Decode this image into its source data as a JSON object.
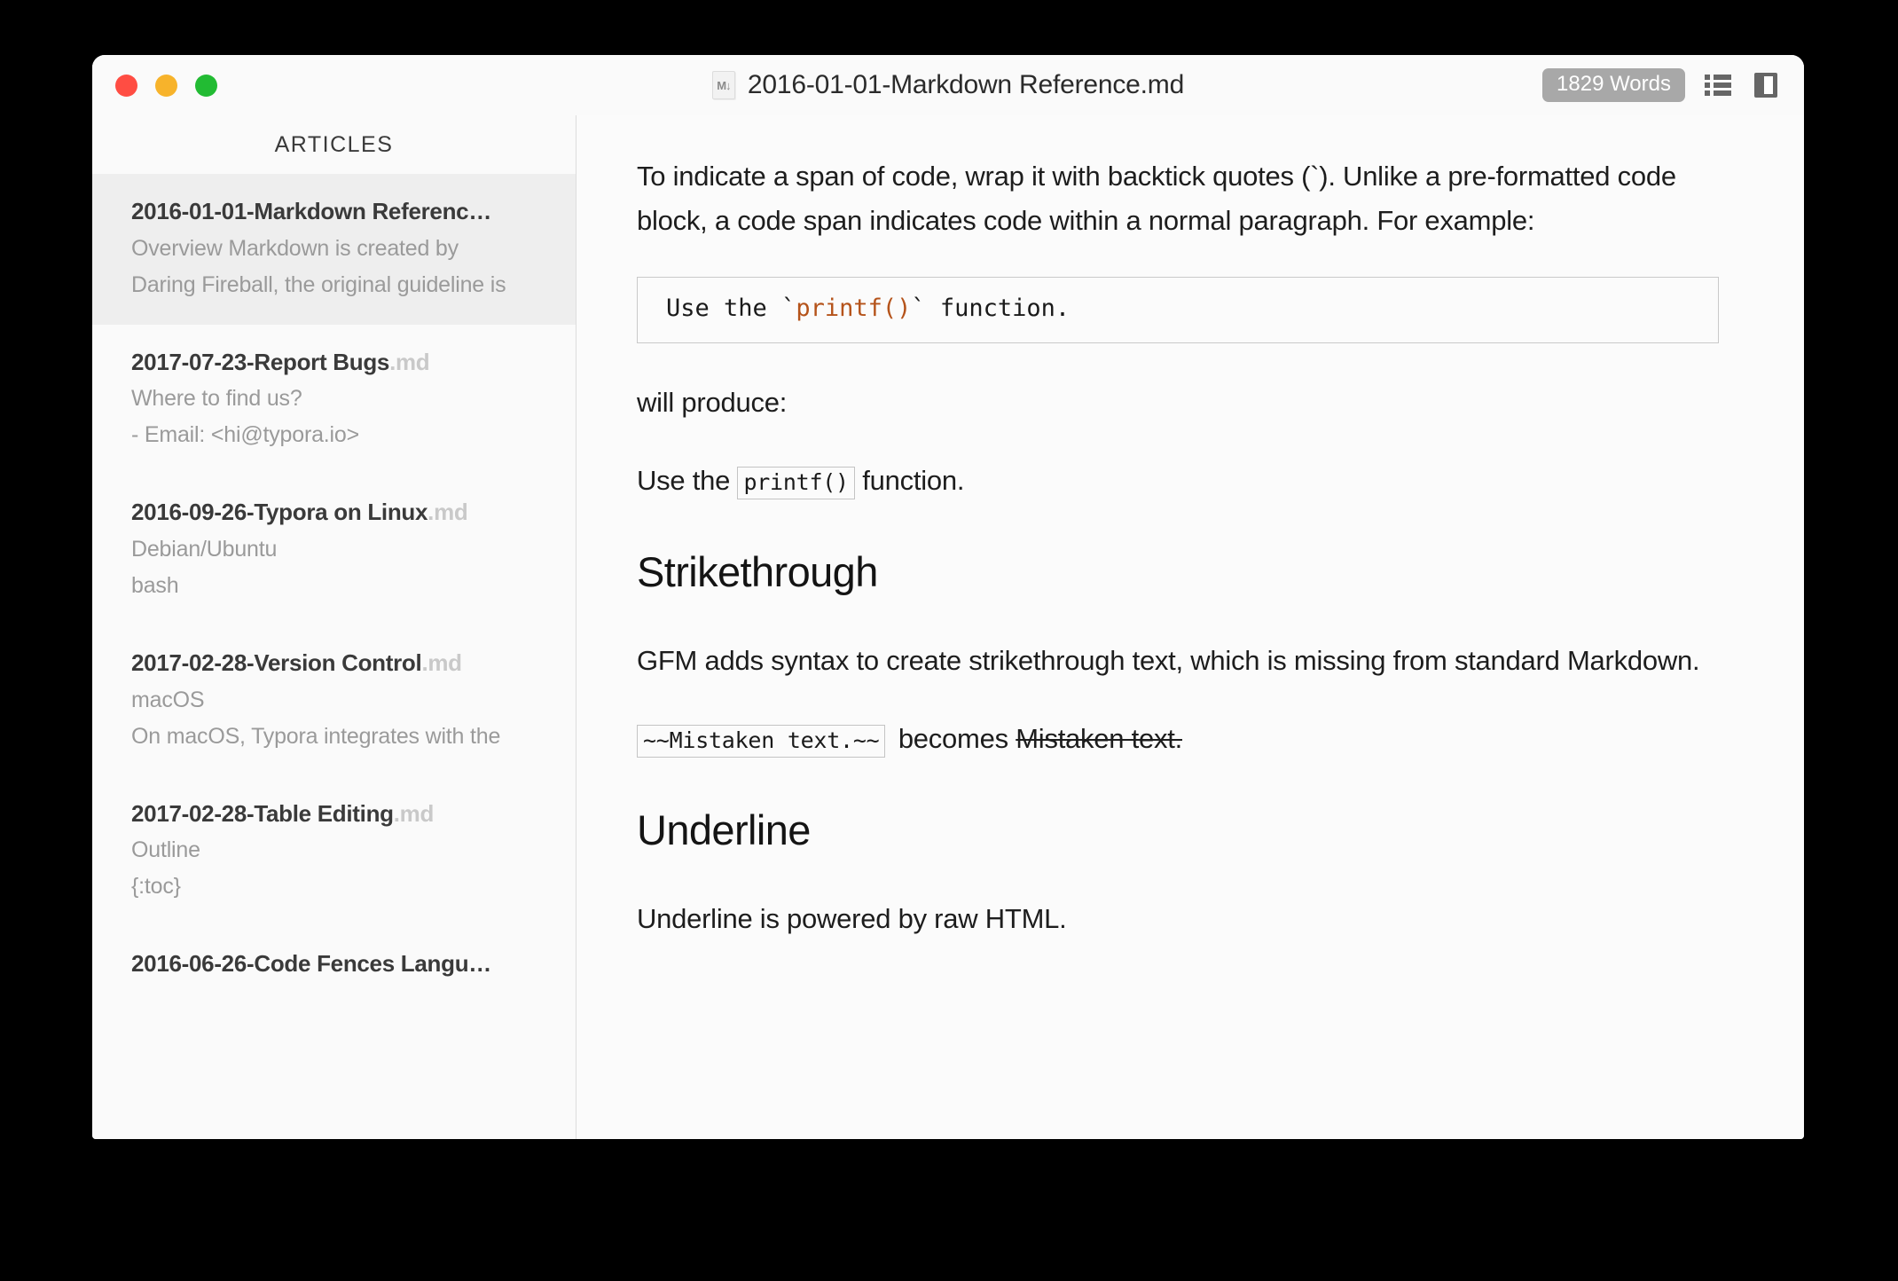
{
  "window": {
    "traffic_lights": [
      "close",
      "minimize",
      "maximize"
    ],
    "colors": {
      "close": "#ff4d43",
      "minimize": "#f7b32b",
      "maximize": "#22bb33",
      "selected_row": "#eeeeee",
      "badge": "#a8a8a8",
      "code_accent": "#b5531a"
    }
  },
  "titlebar": {
    "file_icon_label": "M↓",
    "title": "2016-01-01-Markdown Reference.md",
    "word_count": "1829 Words",
    "outline_icon": "list-icon",
    "sidebar_toggle_icon": "panel-icon"
  },
  "sidebar": {
    "header": "ARTICLES",
    "articles": [
      {
        "name": "2016-01-01-Markdown Referenc…",
        "ext": "",
        "excerpt_lines": [
          "Overview Markdown is created by",
          "Daring Fireball, the original guideline is"
        ],
        "selected": true
      },
      {
        "name": "2017-07-23-Report Bugs",
        "ext": ".md",
        "excerpt_lines": [
          "Where to find us?",
          "- Email: <hi@typora.io>"
        ],
        "selected": false
      },
      {
        "name": "2016-09-26-Typora on Linux",
        "ext": ".md",
        "excerpt_lines": [
          "Debian/Ubuntu",
          "bash"
        ],
        "selected": false
      },
      {
        "name": "2017-02-28-Version Control",
        "ext": ".md",
        "excerpt_lines": [
          "macOS",
          "On macOS, Typora integrates with the"
        ],
        "selected": false
      },
      {
        "name": "2017-02-28-Table Editing",
        "ext": ".md",
        "excerpt_lines": [
          "Outline",
          "{:toc}"
        ],
        "selected": false
      },
      {
        "name": "2016-06-26-Code Fences Langu…",
        "ext": "",
        "excerpt_lines": [],
        "selected": false
      }
    ]
  },
  "document": {
    "para_1": "To indicate a span of code, wrap it with backtick quotes (`). Unlike a pre-formatted code block, a code span indicates code within a normal paragraph. For example:",
    "codeblock_1": {
      "before": "Use the `",
      "highlight": "printf()",
      "after": "` function."
    },
    "para_2": "will produce:",
    "para_3": {
      "before": "Use the ",
      "code": "printf()",
      "after": " function."
    },
    "heading_1": "Strikethrough",
    "para_4": "GFM adds syntax to create strikethrough text, which is missing from standard Markdown.",
    "para_5": {
      "code": "~~Mistaken text.~~",
      "middle": "becomes",
      "struck": "Mistaken text."
    },
    "heading_2": "Underline",
    "para_6": "Underline is powered by raw HTML."
  }
}
